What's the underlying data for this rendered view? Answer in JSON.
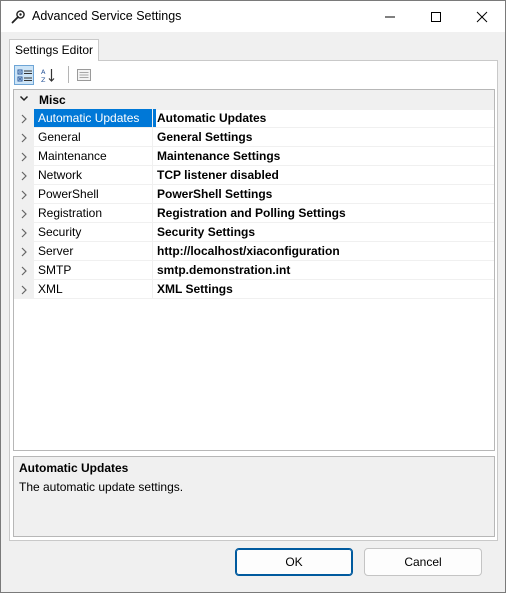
{
  "window": {
    "title": "Advanced Service Settings"
  },
  "tabs": [
    {
      "label": "Settings Editor"
    }
  ],
  "toolbar": {
    "icons": [
      "categorized-view-icon",
      "alphabetical-sort-icon",
      "property-pages-icon"
    ]
  },
  "grid": {
    "category": "Misc",
    "rows": [
      {
        "name": "Automatic Updates",
        "value": "Automatic Updates",
        "selected": true
      },
      {
        "name": "General",
        "value": "General Settings"
      },
      {
        "name": "Maintenance",
        "value": "Maintenance Settings"
      },
      {
        "name": "Network",
        "value": "TCP listener disabled"
      },
      {
        "name": "PowerShell",
        "value": "PowerShell Settings"
      },
      {
        "name": "Registration",
        "value": "Registration and Polling Settings"
      },
      {
        "name": "Security",
        "value": "Security Settings"
      },
      {
        "name": "Server",
        "value": "http://localhost/xiaconfiguration"
      },
      {
        "name": "SMTP",
        "value": "smtp.demonstration.int"
      },
      {
        "name": "XML",
        "value": "XML Settings"
      }
    ]
  },
  "description": {
    "title": "Automatic Updates",
    "text": "The automatic update settings."
  },
  "buttons": {
    "ok": "OK",
    "cancel": "Cancel"
  },
  "colors": {
    "selection": "#0078d7",
    "accent_border": "#005a9e"
  }
}
